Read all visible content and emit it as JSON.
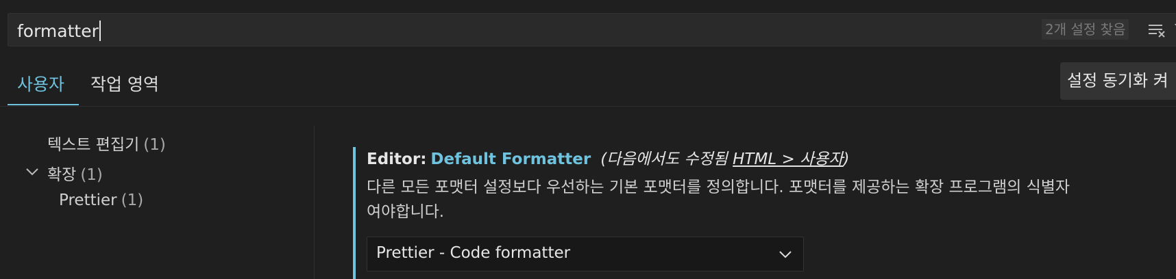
{
  "search": {
    "value": "formatter",
    "result_count": "2개 설정 찾음",
    "clear_icon": "clear-filter-icon",
    "filter_icon": "filter-icon"
  },
  "tabs": [
    {
      "label": "사용자",
      "active": true
    },
    {
      "label": "작업 영역",
      "active": false
    }
  ],
  "sync_button": {
    "label": "설정 동기화 켜"
  },
  "tree": {
    "items": [
      {
        "label": "텍스트 편집기",
        "count": "(1)"
      },
      {
        "label": "확장",
        "count": "(1)",
        "expanded": true
      },
      {
        "label": "Prettier",
        "count": "(1)"
      }
    ]
  },
  "setting": {
    "category": "Editor:",
    "name": "Default Formatter",
    "note_prefix": "(다음에서도 수정됨 ",
    "note_link": "HTML > 사용자",
    "note_suffix": ")",
    "description_line1": "다른 모든 포맷터 설정보다 우선하는 기본 포맷터를 정의합니다. 포맷터를 제공하는 확장 프로그램의 식별자",
    "description_line2": "여야합니다.",
    "dropdown_value": "Prettier - Code formatter"
  },
  "colors": {
    "accent": "#6fc3df",
    "background": "#1f1f1f"
  }
}
